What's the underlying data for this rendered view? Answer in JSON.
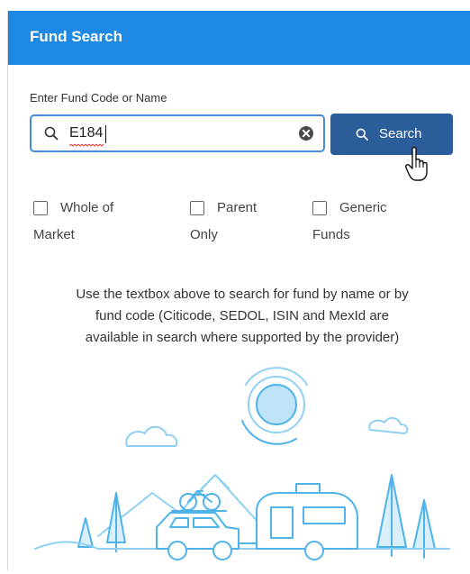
{
  "panel": {
    "title": "Fund Search"
  },
  "search": {
    "label": "Enter Fund Code or Name",
    "value": "E184",
    "button_label": "Search",
    "icon": "search-icon",
    "clear_icon": "clear-icon"
  },
  "filters": [
    {
      "line1": "Whole of",
      "line2": "Market",
      "checked": false
    },
    {
      "line1": "Parent",
      "line2": "Only",
      "checked": false
    },
    {
      "line1": "Generic",
      "line2": "Funds",
      "checked": false
    }
  ],
  "help": {
    "line1": "Use the textbox above to search for fund by name or by",
    "line2": "fund code (Citicode, SEDOL, ISIN and MexId are",
    "line3": "available in search where supported by the provider)"
  },
  "colors": {
    "header": "#1e88e5",
    "button": "#2c5d9b",
    "input_border": "#4a8ad8",
    "illustration": "#4fb3ea"
  }
}
